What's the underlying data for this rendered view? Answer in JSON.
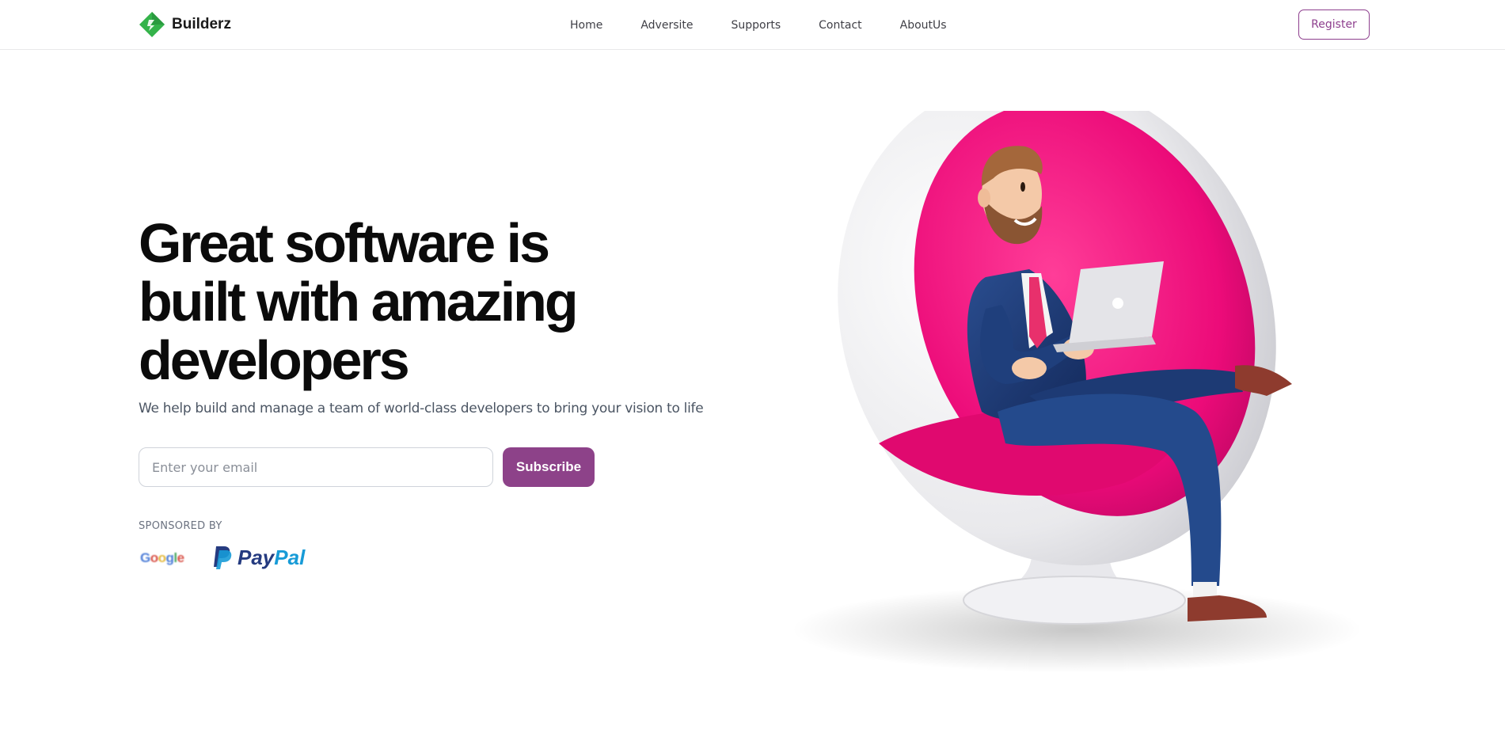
{
  "header": {
    "brand": "Builderz",
    "nav": [
      {
        "label": "Home"
      },
      {
        "label": "Adversite"
      },
      {
        "label": "Supports"
      },
      {
        "label": "Contact"
      },
      {
        "label": "AboutUs"
      }
    ],
    "register_label": "Register"
  },
  "hero": {
    "title_lines": [
      "Great software is",
      "built with amazing",
      "developers"
    ],
    "subtitle": "We help build and manage a team of world-class developers to bring your vision to life",
    "email_placeholder": "Enter your email",
    "email_value": "",
    "subscribe_label": "Subscribe"
  },
  "sponsors": {
    "label": "SPONSORED BY",
    "google_letters": [
      "G",
      "o",
      "o",
      "g",
      "l",
      "e"
    ],
    "paypal_parts": [
      "Pay",
      "Pal"
    ]
  },
  "colors": {
    "brand_green": "#34b34a",
    "accent_purple": "#8d4289",
    "chair_pink": "#ec0b79"
  },
  "icons": {
    "logo": "diamond-logo-icon",
    "paypal": "paypal-p-icon",
    "illustration": "man-in-ball-chair-with-laptop"
  }
}
